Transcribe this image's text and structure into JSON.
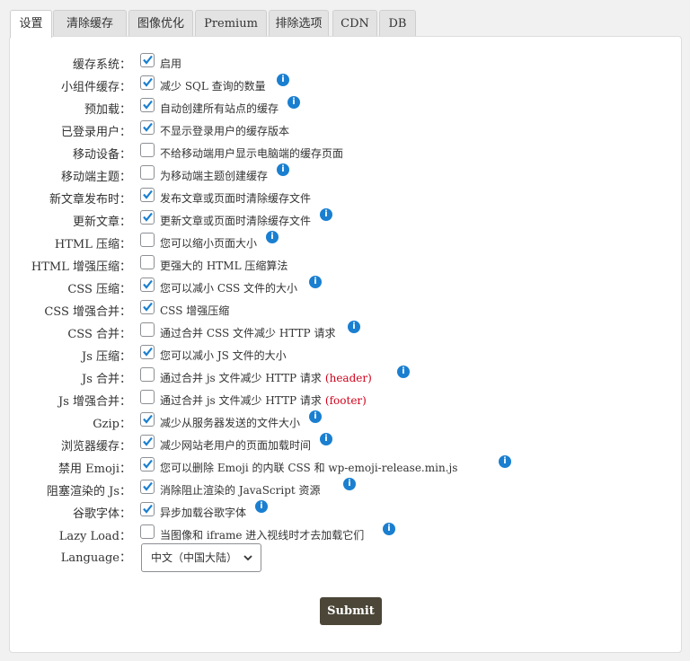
{
  "tabs": [
    "设置",
    "清除缓存",
    "图像优化",
    "Premium",
    "排除选项",
    "CDN",
    "DB"
  ],
  "rows": [
    {
      "label": "缓存系统：",
      "checked": true,
      "desc": "启用",
      "info": false
    },
    {
      "label": "小组件缓存：",
      "checked": true,
      "desc": "减少 SQL 查询的数量",
      "info": true
    },
    {
      "label": "预加载：",
      "checked": true,
      "desc": "自动创建所有站点的缓存",
      "info": true
    },
    {
      "label": "已登录用户：",
      "checked": true,
      "desc": "不显示登录用户的缓存版本",
      "info": false
    },
    {
      "label": "移动设备：",
      "checked": false,
      "desc": "不给移动端用户显示电脑端的缓存页面",
      "info": false
    },
    {
      "label": "移动端主题：",
      "checked": false,
      "desc": "为移动端主题创建缓存",
      "info": true
    },
    {
      "label": "新文章发布时：",
      "checked": true,
      "desc": "发布文章或页面时清除缓存文件",
      "info": false
    },
    {
      "label": "更新文章：",
      "checked": true,
      "desc": "更新文章或页面时清除缓存文件",
      "info": true
    },
    {
      "label": "HTML 压缩：",
      "checked": false,
      "desc": "您可以缩小页面大小",
      "info": true
    },
    {
      "label": "HTML 增强压缩：",
      "checked": false,
      "desc": "更强大的 HTML 压缩算法",
      "info": false
    },
    {
      "label": "CSS 压缩：",
      "checked": true,
      "desc": "您可以减小 CSS 文件的大小",
      "info": true
    },
    {
      "label": "CSS 增强合并：",
      "checked": true,
      "desc": "CSS 增强压缩",
      "info": false
    },
    {
      "label": "CSS 合并：",
      "checked": false,
      "desc": "通过合并 CSS 文件减少 HTTP 请求",
      "info": true
    },
    {
      "label": "Js 压缩：",
      "checked": true,
      "desc": "您可以减小 JS 文件的大小",
      "info": false
    },
    {
      "label": "Js 合并：",
      "checked": false,
      "desc": "通过合并 js 文件减少 HTTP 请求",
      "red": "(header)",
      "info": true
    },
    {
      "label": "Js 增强合并：",
      "checked": false,
      "desc": "通过合并 js 文件减少 HTTP 请求",
      "red": "(footer)",
      "info": false
    },
    {
      "label": "Gzip：",
      "checked": true,
      "desc": "减少从服务器发送的文件大小",
      "info": true
    },
    {
      "label": "浏览器缓存：",
      "checked": true,
      "desc": "减少网站老用户的页面加载时间",
      "info": true
    },
    {
      "label": "禁用 Emoji：",
      "checked": true,
      "desc": "您可以删除 Emoji 的内联 CSS 和 wp-emoji-release.min.js",
      "info": true
    },
    {
      "label": "阻塞渲染的 Js：",
      "checked": true,
      "desc": "消除阻止渲染的 JavaScript 资源",
      "info": true
    },
    {
      "label": "谷歌字体：",
      "checked": true,
      "desc": "异步加载谷歌字体",
      "info": true
    },
    {
      "label": "Lazy Load：",
      "checked": false,
      "desc": "当图像和 iframe 进入视线时才去加载它们",
      "info": true
    }
  ],
  "language": {
    "label": "Language：",
    "value": "中文（中国大陆）"
  },
  "submit_label": "Submit",
  "colors": {
    "accent": "#1a7fd0",
    "submit": "#4b4637",
    "warning": "#d0021b"
  }
}
